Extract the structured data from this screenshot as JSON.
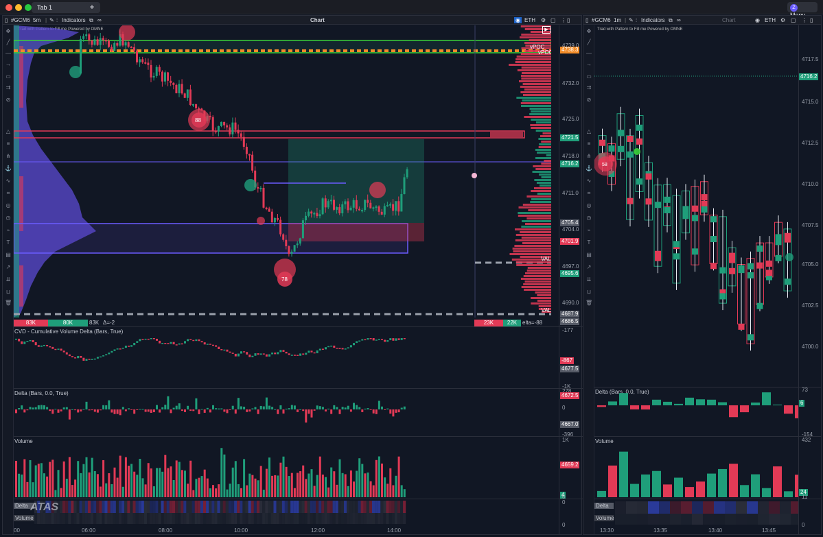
{
  "window": {
    "tab_label": "Tab 1",
    "tab_close": "×",
    "new_tab": "+",
    "menu_label": "Menu",
    "menu_icon": "Z"
  },
  "left_chart": {
    "symbol": "#GCM6",
    "timeframe": "5m",
    "indicators_label": "Indicators",
    "title": "Chart",
    "session": "ETH",
    "powered_by": "Trad with Pattern to Fill me  Powered by OMNE",
    "price_axis": [
      "4739.0",
      "4732.0",
      "4725.0",
      "4718.0",
      "4711.0",
      "4704.0",
      "4697.0",
      "4690.0"
    ],
    "price_tags": [
      {
        "text": "4738.3",
        "color": "#f28c28"
      },
      {
        "text": "4721.5",
        "color": "#1f9e7a"
      },
      {
        "text": "4716.2",
        "color": "#1f9e7a"
      },
      {
        "text": "4705.4",
        "color": "#555a66"
      },
      {
        "text": "4701.9",
        "color": "#e23a56"
      },
      {
        "text": "4695.6",
        "color": "#1f9e7a"
      },
      {
        "text": "4687.9",
        "color": "#555a66"
      },
      {
        "text": "4686.5",
        "color": "#555a66"
      }
    ],
    "profile_labels": {
      "vpoc1": "vPOC",
      "vpoc2": "vPOC",
      "val1": "VAL",
      "val2": "VAL"
    },
    "bubbles": [
      "88",
      "78"
    ],
    "volume_bar": {
      "left_red": "83K",
      "left_green": "80K",
      "left_val": "83K",
      "left_delta": "Δ=-2",
      "right_red": "23K",
      "right_green": "22K",
      "right_delta": "elta=-88"
    },
    "cvd": {
      "label": "CVD - Cumulative Volume Delta (Bars, True)",
      "axis_top": "-177",
      "tag1": "-867",
      "tag2": "4677.5",
      "axis_bottom": "-1K"
    },
    "delta": {
      "label": "Delta (Bars, 0.0, True)",
      "axis_top": "278",
      "tag1": "4672.5",
      "zero": "0",
      "tag2": "4667.0",
      "axis_bottom": "-396"
    },
    "volume": {
      "label": "Volume",
      "axis_top": "1K",
      "tag1": "4659.2",
      "tag2": "4",
      "axis_bottom": "0"
    },
    "footer": {
      "delta": "Delta",
      "volume": "Volume",
      "zero1": "0",
      "zero2": "0",
      "watermark": "ATAS"
    },
    "time_axis": [
      "00",
      "06:00",
      "08:00",
      "10:00",
      "12:00",
      "14:00"
    ]
  },
  "right_chart": {
    "symbol": "#GCM6",
    "timeframe": "1m",
    "indicators_label": "Indicators",
    "title": "Chart",
    "session": "ETH",
    "powered_by": "Trad with Pattern to Fill me  Powered by OMNE",
    "price_axis": [
      "4717.5",
      "4715.0",
      "4712.5",
      "4710.0",
      "4707.5",
      "4705.0",
      "4702.5",
      "4700.0"
    ],
    "current_tag": "4716.2",
    "bubble": "58",
    "delta": {
      "label": "Delta (Bars, 0.0, True)",
      "axis_top": "73",
      "tag": "6",
      "axis_bottom": "-154"
    },
    "volume": {
      "label": "Volume",
      "axis_top": "432",
      "tag": "24",
      "axis_bottom": "11"
    },
    "footer": {
      "delta": "Delta",
      "volume": "Volume",
      "zero": "0"
    },
    "time_axis": [
      "13:30",
      "13:35",
      "13:40",
      "13:45"
    ]
  },
  "colors": {
    "bull": "#1f9e7a",
    "bear": "#e23a56",
    "profile": "#5b4bd1",
    "accent": "#f28c28",
    "bg": "#111724"
  }
}
